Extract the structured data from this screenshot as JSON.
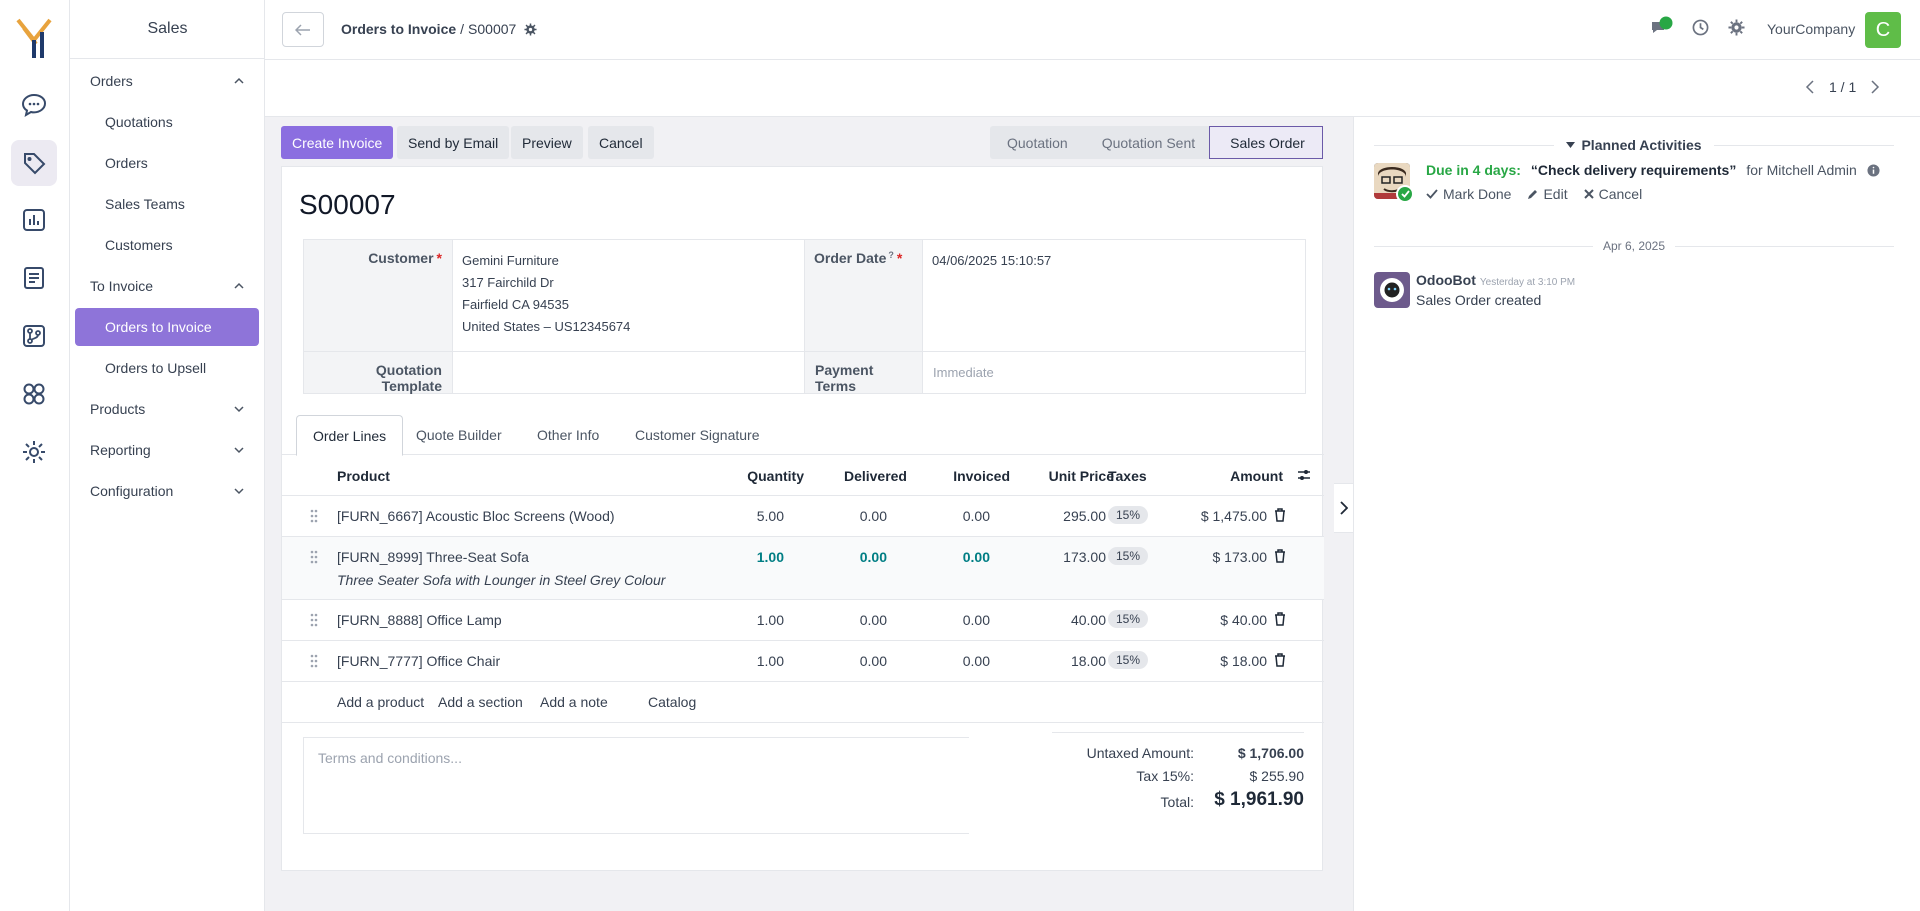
{
  "app": {
    "title": "Sales"
  },
  "sidebar": {
    "items": [
      {
        "label": "Orders"
      },
      {
        "label": "Quotations"
      },
      {
        "label": "Orders"
      },
      {
        "label": "Sales Teams"
      },
      {
        "label": "Customers"
      },
      {
        "label": "To Invoice"
      },
      {
        "label": "Orders to Invoice"
      },
      {
        "label": "Orders to Upsell"
      },
      {
        "label": "Products"
      },
      {
        "label": "Reporting"
      },
      {
        "label": "Configuration"
      }
    ]
  },
  "header": {
    "breadcrumb_parent": "Orders to Invoice",
    "breadcrumb_sep": "/",
    "breadcrumb_current": "S00007",
    "company": "YourCompany",
    "avatar_initial": "C"
  },
  "pager": {
    "text": "1 / 1"
  },
  "actions": {
    "create_invoice": "Create Invoice",
    "send_email": "Send by Email",
    "preview": "Preview",
    "cancel": "Cancel"
  },
  "status": {
    "steps": [
      "Quotation",
      "Quotation Sent",
      "Sales Order"
    ],
    "active": "Sales Order"
  },
  "order": {
    "name": "S00007",
    "customer_label": "Customer",
    "customer_lines": [
      "Gemini Furniture",
      "317 Fairchild Dr",
      "Fairfield CA 94535",
      "United States – US12345674"
    ],
    "order_date_label": "Order Date",
    "order_date_help": "?",
    "order_date": "04/06/2025 15:10:57",
    "template_label": "Quotation Template",
    "payment_terms_label": "Payment Terms",
    "payment_terms_placeholder": "Immediate",
    "required_mark": "*"
  },
  "tabs": [
    "Order Lines",
    "Quote Builder",
    "Other Info",
    "Customer Signature"
  ],
  "order_lines": {
    "headers": {
      "product": "Product",
      "quantity": "Quantity",
      "delivered": "Delivered",
      "invoiced": "Invoiced",
      "unit_price": "Unit Price",
      "taxes": "Taxes",
      "amount": "Amount"
    },
    "rows": [
      {
        "product": "[FURN_6667] Acoustic Bloc Screens (Wood)",
        "description": "",
        "quantity": "5.00",
        "delivered": "0.00",
        "invoiced": "0.00",
        "unit_price": "295.00",
        "tax": "15%",
        "amount": "$ 1,475.00"
      },
      {
        "product": "[FURN_8999] Three-Seat Sofa",
        "description": "Three Seater Sofa with Lounger in Steel Grey Colour",
        "quantity": "1.00",
        "delivered": "0.00",
        "invoiced": "0.00",
        "unit_price": "173.00",
        "tax": "15%",
        "amount": "$ 173.00"
      },
      {
        "product": "[FURN_8888] Office Lamp",
        "description": "",
        "quantity": "1.00",
        "delivered": "0.00",
        "invoiced": "0.00",
        "unit_price": "40.00",
        "tax": "15%",
        "amount": "$ 40.00"
      },
      {
        "product": "[FURN_7777] Office Chair",
        "description": "",
        "quantity": "1.00",
        "delivered": "0.00",
        "invoiced": "0.00",
        "unit_price": "18.00",
        "tax": "15%",
        "amount": "$ 18.00"
      }
    ],
    "add_product": "Add a product",
    "add_section": "Add a section",
    "add_note": "Add a note",
    "catalog": "Catalog"
  },
  "terms": {
    "placeholder": "Terms and conditions..."
  },
  "totals": {
    "untaxed_label": "Untaxed Amount:",
    "untaxed": "$ 1,706.00",
    "tax_label": "Tax 15%:",
    "tax": "$ 255.90",
    "total_label": "Total:",
    "total": "$ 1,961.90"
  },
  "chatter": {
    "planned_title": "Planned Activities",
    "activity": {
      "due": "Due in 4 days:",
      "summary": "“Check delivery requirements”",
      "for": "for Mitchell Admin",
      "mark_done": "Mark Done",
      "edit": "Edit",
      "cancel": "Cancel"
    },
    "date_separator": "Apr 6, 2025",
    "message": {
      "author": "OdooBot",
      "time": "Yesterday at 3:10 PM",
      "body": "Sales Order created"
    }
  },
  "colors": {
    "primary": "#8b6ee0",
    "sidebar_active": "#8e74d9",
    "teal": "#017e84",
    "due_green": "#28a745",
    "avatar_green": "#5fbd48"
  },
  "icons": [
    "logo-icon",
    "discuss-icon",
    "sales-tag-icon",
    "dashboard-icon",
    "document-icon",
    "git-icon",
    "apps-icon",
    "settings-icon",
    "back-arrow-icon",
    "gear-icon",
    "chat-icon",
    "clock-icon",
    "settings-gear-icon",
    "chevron-left-icon",
    "chevron-right-icon",
    "drag-handle-icon",
    "trash-icon",
    "optional-columns-icon",
    "caret-down-icon",
    "check-icon",
    "pencil-icon",
    "times-icon",
    "info-icon"
  ]
}
